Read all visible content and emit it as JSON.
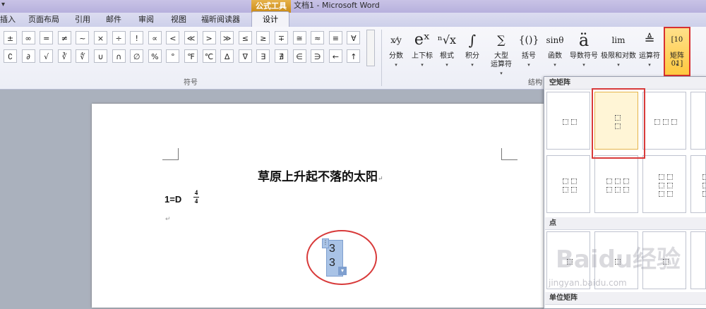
{
  "titlebar": {
    "context_tab": "公式工具",
    "doc_title": "文档1 - Microsoft Word",
    "qat_arrow": "▾"
  },
  "tabs": [
    "插入",
    "页面布局",
    "引用",
    "邮件",
    "审阅",
    "视图",
    "福昕阅读器"
  ],
  "active_tab": "设计",
  "symbols": {
    "row1": [
      "±",
      "∞",
      "=",
      "≠",
      "~",
      "×",
      "÷",
      "!",
      "∝",
      "<",
      "≪",
      ">",
      "≫",
      "≤",
      "≥",
      "∓",
      "≅",
      "≈",
      "≡",
      "∀"
    ],
    "row2": [
      "∁",
      "∂",
      "√",
      "∛",
      "∜",
      "∪",
      "∩",
      "∅",
      "%",
      "°",
      "℉",
      "℃",
      "∆",
      "∇",
      "∃",
      "∄",
      "∈",
      "∋",
      "←",
      "↑"
    ],
    "group_label": "符号"
  },
  "structures": {
    "group_label": "结构",
    "buttons": [
      {
        "label": "分数",
        "glyph": "x⁄y"
      },
      {
        "label": "上下标",
        "glyph": "eˣ"
      },
      {
        "label": "根式",
        "glyph": "ⁿ√x"
      },
      {
        "label": "积分",
        "glyph": "∫"
      },
      {
        "label": "大型",
        "sub": "运算符",
        "glyph": "∑"
      },
      {
        "label": "括号",
        "glyph": "{()}"
      },
      {
        "label": "函数",
        "glyph": "sinθ"
      },
      {
        "label": "导数符号",
        "glyph": "ä"
      },
      {
        "label": "极限和对数",
        "glyph": "lim"
      },
      {
        "label": "运算符",
        "glyph": "≜"
      },
      {
        "label": "矩阵",
        "glyph": "[10 01]"
      }
    ]
  },
  "document": {
    "heading": "草原上升起不落的太阳",
    "key_prefix": "1=D",
    "time_sig_top": "4",
    "time_sig_bottom": "4",
    "para_mark": "↵",
    "equation_values": [
      "3",
      "3"
    ]
  },
  "gallery": {
    "sections": [
      "空矩阵",
      "点",
      "单位矩阵"
    ]
  },
  "watermark": {
    "main": "Baidu经验",
    "sub": "jingyan.baidu.com"
  },
  "colors": {
    "highlight_red": "#d83a3a",
    "matrix_button_yellow": "#ffc940",
    "equation_blue": "#a9c3e6"
  }
}
